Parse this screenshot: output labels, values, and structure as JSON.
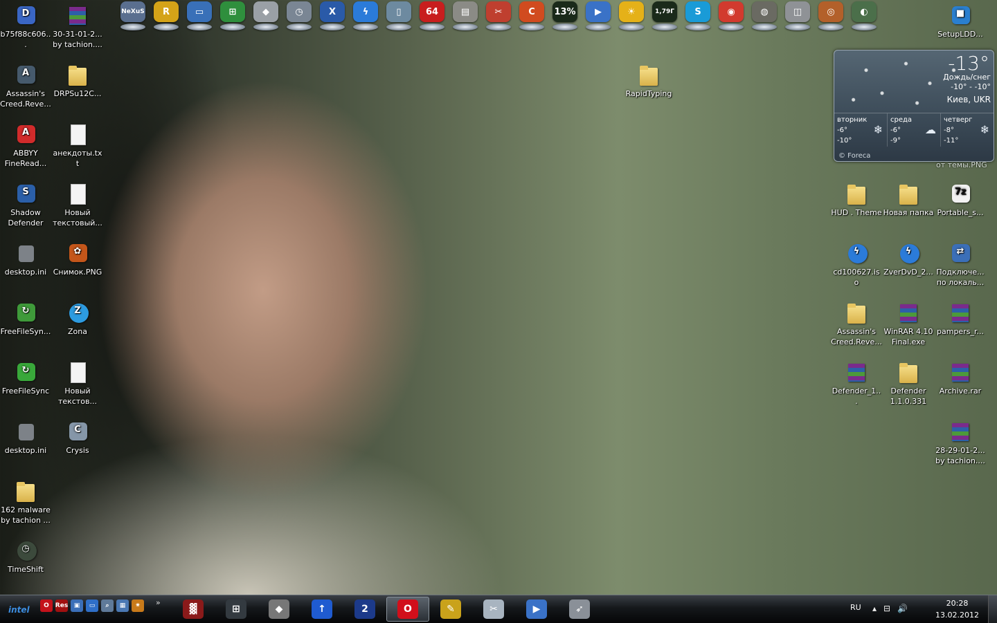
{
  "dock": {
    "items": [
      {
        "name": "nexus-icon",
        "mark": "NeXuS",
        "color": "#5a6f8f"
      },
      {
        "name": "rocketdock-icon",
        "mark": "R",
        "color": "#d4a318"
      },
      {
        "name": "computer-icon",
        "mark": "▭",
        "color": "#3970b8"
      },
      {
        "name": "windows-icon",
        "mark": "⊞",
        "color": "#2f8f3d"
      },
      {
        "name": "foobar-icon",
        "mark": "◆",
        "color": "#9aa0a6"
      },
      {
        "name": "clock-icon",
        "mark": "◷",
        "color": "#7a8694"
      },
      {
        "name": "xbox-icon",
        "mark": "X",
        "color": "#2a5aa8"
      },
      {
        "name": "daemon-tools-icon",
        "mark": "ϟ",
        "color": "#2b7bd9"
      },
      {
        "name": "recycle-bin-icon",
        "mark": "▯",
        "color": "#6d8aa0"
      },
      {
        "name": "aida64-icon",
        "mark": "64",
        "color": "#c81e1e"
      },
      {
        "name": "scanner-icon",
        "mark": "▤",
        "color": "#8b8b86"
      },
      {
        "name": "tools-icon",
        "mark": "✂",
        "color": "#bf3f2f"
      },
      {
        "name": "ccleaner-icon",
        "mark": "C",
        "color": "#d14b1f"
      },
      {
        "name": "cpu-meter-icon",
        "mark": "13%",
        "color": "#1a2a1a"
      },
      {
        "name": "media-player-icon",
        "mark": "▶",
        "color": "#3a72c7"
      },
      {
        "name": "weather-icon",
        "mark": "☀",
        "color": "#e5b118"
      },
      {
        "name": "memory-meter-icon",
        "mark": "1,79Г",
        "color": "#1a2a1a"
      },
      {
        "name": "skype-icon",
        "mark": "S",
        "color": "#1a9bd7"
      },
      {
        "name": "chrome-icon",
        "mark": "◉",
        "color": "#d23a2e"
      },
      {
        "name": "globe-icon",
        "mark": "◍",
        "color": "#6a6a62"
      },
      {
        "name": "camera-icon",
        "mark": "◫",
        "color": "#8f9296"
      },
      {
        "name": "eye-icon",
        "mark": "◎",
        "color": "#b3602a"
      },
      {
        "name": "webcam-icon",
        "mark": "◐",
        "color": "#4b6f4a"
      }
    ]
  },
  "left_icons": [
    {
      "label": "b75f88c606...",
      "type": "app",
      "color": "#3a66c4",
      "mark": "D"
    },
    {
      "label": "30-31-01-2... by tachion....",
      "type": "rar"
    },
    {
      "label": "Assassin's Creed.Reve...",
      "type": "app",
      "color": "#465a6c",
      "mark": "A"
    },
    {
      "label": "DRPSu12C...",
      "type": "folder"
    },
    {
      "label": "ABBYY FineRead...",
      "type": "app",
      "color": "#d12b2b",
      "mark": "A"
    },
    {
      "label": "анекдоты.txt",
      "type": "doc"
    },
    {
      "label": "Shadow Defender",
      "type": "app",
      "color": "#2b5fa8",
      "mark": "S"
    },
    {
      "label": "Новый текстовый...",
      "type": "doc"
    },
    {
      "label": "desktop.ini",
      "type": "gear"
    },
    {
      "label": "Снимок.PNG",
      "type": "app",
      "color": "#c4561a",
      "mark": "✿"
    },
    {
      "label": "FreeFileSyn...",
      "type": "app",
      "color": "#3f9a3a",
      "mark": "↻"
    },
    {
      "label": "Zona",
      "type": "circle",
      "color": "#2d9be0",
      "mark": "Z"
    },
    {
      "label": "FreeFileSync",
      "type": "app",
      "color": "#39a83a",
      "mark": "↻"
    },
    {
      "label": "Новый текстов...",
      "type": "doc"
    },
    {
      "label": "desktop.ini",
      "type": "gear"
    },
    {
      "label": "Crysis",
      "type": "app",
      "color": "#8596a8",
      "mark": "C"
    },
    {
      "label": "162 malware by tachion ...",
      "type": "folder"
    },
    {
      "label": "TimeShift",
      "type": "circle",
      "color": "#3c4a3c",
      "mark": "◷"
    }
  ],
  "mid_icons": [
    {
      "label": "RapidTyping",
      "type": "folder"
    }
  ],
  "right_icons": [
    {
      "label": "SetupLDD...",
      "type": "app",
      "color": "#2a7fcf",
      "mark": "■"
    },
    {
      "label": "HUD . Theme",
      "type": "folder"
    },
    {
      "label": "Новая папка",
      "type": "folder"
    },
    {
      "label": "Portable_s...",
      "type": "app",
      "color": "#f2f2f2",
      "mark": "7z"
    },
    {
      "label": "cd100627.iso",
      "type": "circle",
      "color": "#2b7bd9",
      "mark": "ϟ"
    },
    {
      "label": "ZverDvD_2...",
      "type": "circle",
      "color": "#2b7bd9",
      "mark": "ϟ"
    },
    {
      "label": "Подключе... по локаль...",
      "type": "app",
      "color": "#3b6fb8",
      "mark": "⇄"
    },
    {
      "label": "Assassin's Creed.Reve...",
      "type": "folder"
    },
    {
      "label": "WinRAR 4.10 Final.exe",
      "type": "rar"
    },
    {
      "label": "pampers_r...",
      "type": "rar"
    },
    {
      "label": "Defender_1...",
      "type": "rar"
    },
    {
      "label": "Defender 1.1.0.331",
      "type": "folder"
    },
    {
      "label": "Archive.rar",
      "type": "rar"
    },
    {
      "label": "28-29-01-2... by tachion....",
      "type": "rar"
    }
  ],
  "weather": {
    "temp": "-13°",
    "condition": "Дождь/снег",
    "range": "-10° - -10°",
    "city": "Киев, UKR",
    "days": [
      {
        "name": "вторник",
        "hi": "-6°",
        "lo": "-10°"
      },
      {
        "name": "среда",
        "hi": "-6°",
        "lo": "-9°"
      },
      {
        "name": "четверг",
        "hi": "-8°",
        "lo": "-11°"
      }
    ],
    "credit": "© Foreca",
    "sub_label": "от темы.PNG"
  },
  "taskbar": {
    "intel": "intel",
    "quick_launch": [
      {
        "name": "opera-quick-icon",
        "mark": "O",
        "color": "#c4121b"
      },
      {
        "name": "res-quick-icon",
        "mark": "Res",
        "color": "#a01010"
      },
      {
        "name": "window-quick-icon",
        "mark": "▣",
        "color": "#3b6fb8"
      },
      {
        "name": "desktop-quick-icon",
        "mark": "▭",
        "color": "#2f6fc8"
      },
      {
        "name": "search-quick-icon",
        "mark": "⌕",
        "color": "#5f7a99"
      },
      {
        "name": "network-quick-icon",
        "mark": "▦",
        "color": "#4a78b3"
      },
      {
        "name": "sun-quick-icon",
        "mark": "✷",
        "color": "#c87a1a"
      }
    ],
    "chevron": "»",
    "tasks": [
      {
        "name": "game-task-icon",
        "mark": "▓",
        "color": "#8a1a1a",
        "active": false
      },
      {
        "name": "windows-task-icon",
        "mark": "⊞",
        "color": "#333a40",
        "active": false
      },
      {
        "name": "foobar-task-icon",
        "mark": "◆",
        "color": "#777",
        "active": false
      },
      {
        "name": "upload-task-icon",
        "mark": "↑",
        "color": "#1f5bd0",
        "active": false
      },
      {
        "name": "manager-task-icon",
        "mark": "2",
        "color": "#1c3a8a",
        "active": false
      },
      {
        "name": "opera-task-icon",
        "mark": "O",
        "color": "#d10f1b",
        "active": true
      },
      {
        "name": "pencil-task-icon",
        "mark": "✎",
        "color": "#c9a21b",
        "active": false
      },
      {
        "name": "scissors-task-icon",
        "mark": "✂",
        "color": "#a8b4c0",
        "active": false
      },
      {
        "name": "media-task-icon",
        "mark": "▶",
        "color": "#3a72c7",
        "active": false
      },
      {
        "name": "rocket-task-icon",
        "mark": "➶",
        "color": "#8a9098",
        "active": false
      }
    ],
    "lang": "RU",
    "tray": [
      "▴",
      "⊟",
      "🔊"
    ],
    "time": "20:28",
    "date": "13.02.2012"
  }
}
